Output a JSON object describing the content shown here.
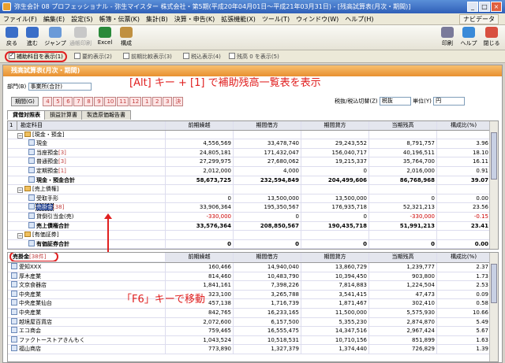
{
  "window": {
    "title": "弥生会計 08 プロフェッショナル - 弥生マイスター 株式会社・第5期(平成20年04月01日～平成21年03月31日) - [残高試算表(月次・期間)]",
    "min": "_",
    "max": "□",
    "close": "×"
  },
  "menu": [
    "ファイル(F)",
    "編集(E)",
    "設定(S)",
    "帳簿・伝票(K)",
    "集計(B)",
    "決算・申告(K)",
    "拡張機能(X)",
    "ツール(T)",
    "ウィンドウ(W)",
    "ヘルプ(H)"
  ],
  "navi": "ナビデータ",
  "toolbar": {
    "back": "戻る",
    "forward": "進む",
    "jump": "ジャンプ",
    "print_preview": "通帳印刷",
    "excel": "Excel",
    "layout": "構成",
    "print": "印刷",
    "help": "ヘルプ",
    "close": "閉じる"
  },
  "options": [
    "補助科目を表示(1)",
    "要約表示(2)",
    "前期比較表示(3)",
    "税込表示(4)",
    "残高 0 を表示(5)"
  ],
  "panel_title": "残高試算表(月次・期間)",
  "callout1": "[Alt] キー + [1] で補助残高一覧表を表示",
  "callout2": "「F6」キーで移動",
  "dept": {
    "label": "部門(B)",
    "value": "事業所(合計)"
  },
  "period": {
    "label": "期間(G)",
    "months": [
      "4",
      "5",
      "6",
      "7",
      "8",
      "9",
      "10",
      "11",
      "12",
      "1",
      "2",
      "3",
      "決"
    ]
  },
  "controls": {
    "tax_label": "税抜/税込切替(Z)",
    "tax_value": "税抜",
    "unit_label": "単位(Y)",
    "unit_value": "円"
  },
  "tabs": [
    "貸借対照表",
    "損益計算書",
    "製造原価報告書"
  ],
  "main_header": [
    "勘定科目",
    "前期繰越",
    "期間借方",
    "期間貸方",
    "当期残高",
    "構成比(%)"
  ],
  "main_header_index": "1",
  "main_rows": [
    {
      "name": "[現金・預金]",
      "type": "group",
      "indent": 1
    },
    {
      "name": "現金",
      "values": [
        "4,556,569",
        "33,478,740",
        "29,243,552",
        "8,791,757",
        "3.96"
      ],
      "indent": 2
    },
    {
      "name": "当座預金",
      "sub": "[3]",
      "values": [
        "24,805,181",
        "171,432,047",
        "156,040,717",
        "40,196,511",
        "18.10"
      ],
      "indent": 2
    },
    {
      "name": "普通預金",
      "sub": "[3]",
      "values": [
        "27,299,975",
        "27,680,062",
        "19,215,337",
        "35,764,700",
        "16.11"
      ],
      "indent": 2
    },
    {
      "name": "定期預金",
      "sub": "[1]",
      "values": [
        "2,012,000",
        "4,000",
        "0",
        "2,016,000",
        "0.91"
      ],
      "indent": 2
    },
    {
      "name": "現金・預金合計",
      "values": [
        "58,673,725",
        "232,594,849",
        "204,499,606",
        "86,768,968",
        "39.07"
      ],
      "indent": 2,
      "bold": true
    },
    {
      "name": "[売上債権]",
      "type": "group",
      "indent": 1
    },
    {
      "name": "受取手形",
      "values": [
        "0",
        "13,500,000",
        "13,500,000",
        "0",
        "0.00"
      ],
      "indent": 2
    },
    {
      "name": "売掛金",
      "sub": "[38]",
      "values": [
        "33,906,364",
        "195,350,567",
        "176,935,718",
        "52,321,213",
        "23.56"
      ],
      "indent": 2,
      "selected": true
    },
    {
      "name": "貸倒引当金(売)",
      "values": [
        "-330,000",
        "0",
        "0",
        "-330,000",
        "-0.15"
      ],
      "indent": 2,
      "neg": true
    },
    {
      "name": "売上債権合計",
      "values": [
        "33,576,364",
        "208,850,567",
        "190,435,718",
        "51,991,213",
        "23.41"
      ],
      "indent": 2,
      "bold": true
    },
    {
      "name": "[有価証券]",
      "type": "group",
      "indent": 1
    },
    {
      "name": "有価証券合計",
      "values": [
        "0",
        "0",
        "0",
        "0",
        "0.00"
      ],
      "indent": 2,
      "bold": true
    }
  ],
  "sub_header": [
    "",
    "前期繰越",
    "期間借方",
    "期間貸方",
    "当期残高",
    "構成比(%)"
  ],
  "sub_title": "売掛金",
  "sub_count": "[38件]",
  "sub_rows": [
    {
      "name": "愛知XXX",
      "values": [
        "160,466",
        "14,940,040",
        "13,860,729",
        "1,239,777",
        "2.37"
      ]
    },
    {
      "name": "厚木産業",
      "values": [
        "814,460",
        "10,483,790",
        "10,394,450",
        "903,800",
        "1.73"
      ]
    },
    {
      "name": "文京食器店",
      "values": [
        "1,841,161",
        "7,398,226",
        "7,814,883",
        "1,224,504",
        "2.53"
      ]
    },
    {
      "name": "中央産業",
      "values": [
        "323,100",
        "3,265,788",
        "3,541,415",
        "47,473",
        "0.09"
      ]
    },
    {
      "name": "中央産業仙台",
      "values": [
        "457,138",
        "1,716,739",
        "1,871,467",
        "302,410",
        "0.58"
      ]
    },
    {
      "name": "中央産業",
      "values": [
        "842,765",
        "16,233,165",
        "11,500,000",
        "5,575,930",
        "10.66"
      ]
    },
    {
      "name": "越境屋百貨店",
      "values": [
        "2,072,600",
        "6,157,500",
        "5,355,230",
        "2,874,870",
        "5.49"
      ]
    },
    {
      "name": "エコ商会",
      "values": [
        "759,465",
        "16,555,475",
        "14,347,516",
        "2,967,424",
        "5.67"
      ]
    },
    {
      "name": "ファクトーストアきんもく",
      "values": [
        "1,043,524",
        "10,518,531",
        "10,710,156",
        "851,899",
        "1.63"
      ]
    },
    {
      "name": "福山商店",
      "values": [
        "773,890",
        "1,327,379",
        "1,374,440",
        "726,829",
        "1.39"
      ]
    }
  ]
}
